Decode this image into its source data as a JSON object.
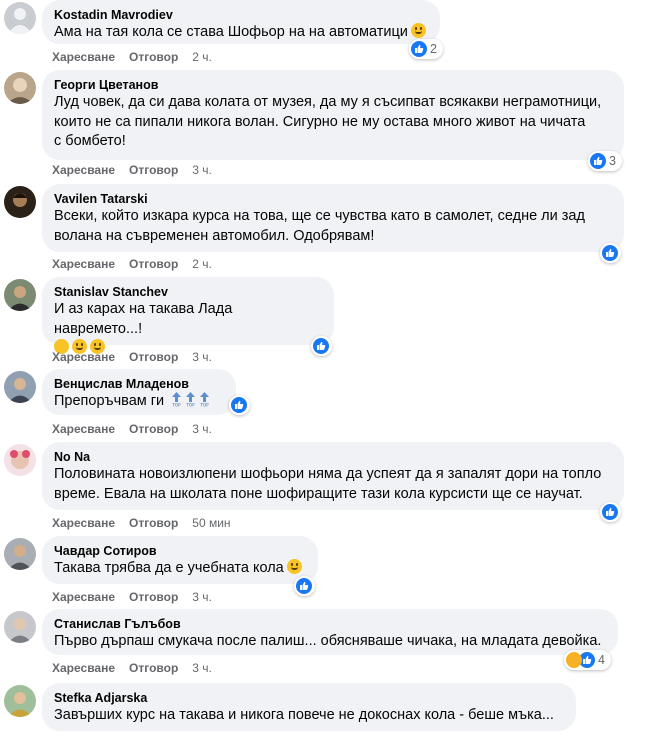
{
  "labels": {
    "like": "Харесване",
    "reply": "Отговор",
    "sep": "·"
  },
  "colors": {
    "like_blue": "#1877f2",
    "bubble_bg": "#f0f2f5",
    "meta_gray": "#65676b"
  },
  "comments": [
    {
      "author": "Kostadin Mavrodiev",
      "text": "Ама на тая кола се става Шофьор на на автоматици",
      "emoji": [
        "smile-emoji"
      ],
      "time": "2 ч.",
      "reactions": {
        "icons": [
          "like-icon"
        ],
        "count": "2"
      }
    },
    {
      "author": "Георги Цветанов",
      "lines": [
        "Луд човек, да си дава колата от музея, да му я съсипват всякакви неграмотници,",
        "които не са пипали никога волан. Сигурно не му остава много живот на чичата",
        "с бомбето!"
      ],
      "time": "3 ч.",
      "reactions": {
        "icons": [
          "like-icon"
        ],
        "count": "3"
      }
    },
    {
      "author": "Vavilen Tatarski",
      "lines": [
        "Всеки, който изкара курса на това, ще се чувства като в самолет, седне ли зад",
        "волана на съвременен автомобил. Одобрявам!"
      ],
      "time": "2 ч.",
      "reactions": {
        "icons": [
          "like-icon"
        ],
        "count": ""
      }
    },
    {
      "author": "Stanislav Stanchev",
      "text": "И аз карах на такава Лада навремето...!",
      "emoji": [
        "thinking-emoji",
        "smile-emoji",
        "grin-emoji"
      ],
      "time": "3 ч.",
      "reactions": {
        "icons": [
          "like-icon"
        ],
        "count": ""
      }
    },
    {
      "author": "Венцислав Младенов",
      "text": "Препоръчвам ги",
      "emoji": [
        "top-emoji",
        "top-emoji",
        "top-emoji"
      ],
      "time": "3 ч.",
      "reactions": {
        "icons": [
          "like-icon"
        ],
        "count": ""
      }
    },
    {
      "author": "No Na",
      "lines": [
        "Половината новоизлюпени шофьори няма да успеят да я запалят дори на топло",
        "време. Евала на школата поне шофиращите тази кола курсисти ще се научат."
      ],
      "time": "50 мин",
      "reactions": {
        "icons": [
          "like-icon"
        ],
        "count": ""
      }
    },
    {
      "author": "Чавдар Сотиров",
      "text": "Такава трябва да е учебната кола",
      "emoji": [
        "smile-emoji"
      ],
      "time": "3 ч.",
      "reactions": {
        "icons": [
          "like-icon"
        ],
        "count": ""
      }
    },
    {
      "author": "Станислав Гълъбов",
      "text": "Първо дърпаш смукача после палиш... обясняваше чичака, на младата девойка.",
      "time": "3 ч.",
      "reactions": {
        "icons": [
          "haha-icon",
          "like-icon"
        ],
        "count": "4"
      }
    },
    {
      "author": "Stefka Adjarska",
      "text": "Завърших курс на такава и никога повече не докоснах кола - беше мъка..."
    }
  ]
}
